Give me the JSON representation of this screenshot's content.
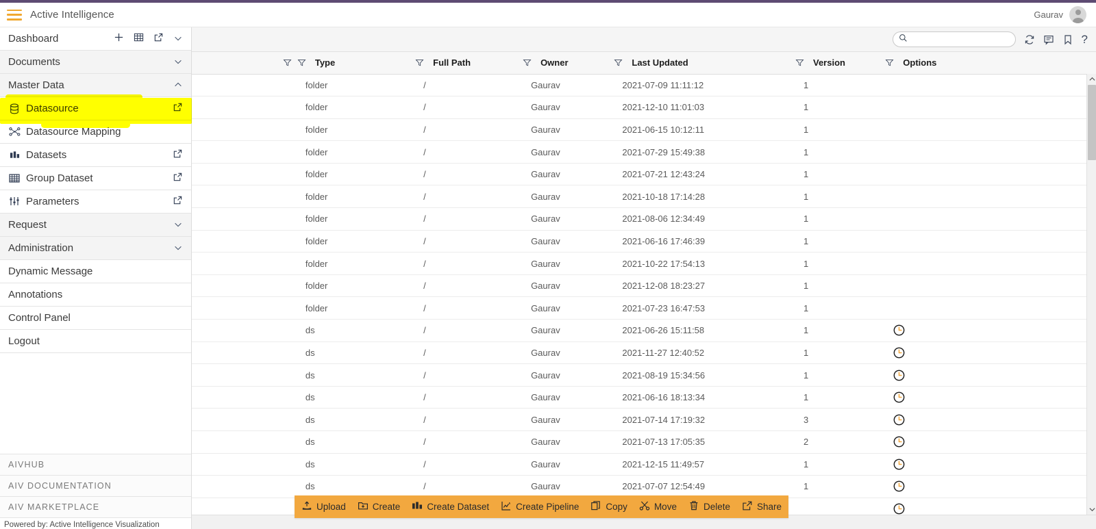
{
  "app": {
    "title": "Active Intelligence",
    "user": "Gaurav",
    "menu_icon": "hamburger-icon",
    "avatar_icon": "user-avatar-icon",
    "powered_by": "Powered by: Active Intelligence Visualization",
    "accent_top": "#5e4b73",
    "accent_orange": "#f2a83f",
    "highlight": "#ffff00"
  },
  "sidebar": {
    "items": [
      {
        "label": "Dashboard",
        "icon": null,
        "style": "plain",
        "actions": [
          "plus-icon",
          "table-icon",
          "external-link-icon",
          "chevron-down-icon"
        ]
      },
      {
        "label": "Documents",
        "icon": null,
        "style": "grey",
        "actions": [
          "chevron-down-icon"
        ]
      },
      {
        "label": "Master Data",
        "icon": null,
        "style": "grey",
        "actions": [
          "chevron-up-icon"
        ]
      },
      {
        "label": "Datasource",
        "icon": "database-icon",
        "style": "plain",
        "actions": [
          "external-link-icon"
        ],
        "highlighted": true
      },
      {
        "label": "Datasource Mapping",
        "icon": "datasource-mapping-icon",
        "style": "plain",
        "actions": []
      },
      {
        "label": "Datasets",
        "icon": "dataset-icon",
        "style": "plain",
        "actions": [
          "external-link-icon"
        ]
      },
      {
        "label": "Group Dataset",
        "icon": "group-dataset-icon",
        "style": "plain",
        "actions": [
          "external-link-icon"
        ]
      },
      {
        "label": "Parameters",
        "icon": "sliders-icon",
        "style": "plain",
        "actions": [
          "external-link-icon"
        ]
      },
      {
        "label": "Request",
        "icon": null,
        "style": "grey",
        "actions": [
          "chevron-down-icon"
        ]
      },
      {
        "label": "Administration",
        "icon": null,
        "style": "grey",
        "actions": [
          "chevron-down-icon"
        ]
      },
      {
        "label": "Dynamic Message",
        "icon": null,
        "style": "plain",
        "actions": []
      },
      {
        "label": "Annotations",
        "icon": null,
        "style": "plain",
        "actions": []
      },
      {
        "label": "Control Panel",
        "icon": null,
        "style": "plain",
        "actions": []
      },
      {
        "label": "Logout",
        "icon": null,
        "style": "plain",
        "actions": []
      }
    ],
    "external_links": [
      "AIVHUB",
      "AIV DOCUMENTATION",
      "AIV MARKETPLACE"
    ]
  },
  "toolbar": {
    "search_value": "",
    "search_placeholder": "",
    "icons": [
      "search-icon",
      "refresh-icon",
      "comment-icon",
      "bookmark-icon",
      "help-icon"
    ],
    "help_label": "?"
  },
  "table": {
    "columns": [
      {
        "key": "name",
        "label": "",
        "filter": true
      },
      {
        "key": "type",
        "label": "Type",
        "filter": true
      },
      {
        "key": "path",
        "label": "Full Path",
        "filter": true
      },
      {
        "key": "owner",
        "label": "Owner",
        "filter": true
      },
      {
        "key": "updated",
        "label": "Last Updated",
        "filter": true
      },
      {
        "key": "version",
        "label": "Version",
        "filter": true
      },
      {
        "key": "options",
        "label": "Options",
        "filter": true
      }
    ],
    "rows": [
      {
        "name": "",
        "type": "folder",
        "path": "/",
        "owner": "Gaurav",
        "updated": "2021-07-09 11:11:12",
        "version": "1",
        "options": ""
      },
      {
        "name": "",
        "type": "folder",
        "path": "/",
        "owner": "Gaurav",
        "updated": "2021-12-10 11:01:03",
        "version": "1",
        "options": ""
      },
      {
        "name": "",
        "type": "folder",
        "path": "/",
        "owner": "Gaurav",
        "updated": "2021-06-15 10:12:11",
        "version": "1",
        "options": ""
      },
      {
        "name": "",
        "type": "folder",
        "path": "/",
        "owner": "Gaurav",
        "updated": "2021-07-29 15:49:38",
        "version": "1",
        "options": ""
      },
      {
        "name": "",
        "type": "folder",
        "path": "/",
        "owner": "Gaurav",
        "updated": "2021-07-21 12:43:24",
        "version": "1",
        "options": ""
      },
      {
        "name": "",
        "type": "folder",
        "path": "/",
        "owner": "Gaurav",
        "updated": "2021-10-18 17:14:28",
        "version": "1",
        "options": ""
      },
      {
        "name": "",
        "type": "folder",
        "path": "/",
        "owner": "Gaurav",
        "updated": "2021-08-06 12:34:49",
        "version": "1",
        "options": ""
      },
      {
        "name": "",
        "type": "folder",
        "path": "/",
        "owner": "Gaurav",
        "updated": "2021-06-16 17:46:39",
        "version": "1",
        "options": ""
      },
      {
        "name": "",
        "type": "folder",
        "path": "/",
        "owner": "Gaurav",
        "updated": "2021-10-22 17:54:13",
        "version": "1",
        "options": ""
      },
      {
        "name": "",
        "type": "folder",
        "path": "/",
        "owner": "Gaurav",
        "updated": "2021-12-08 18:23:27",
        "version": "1",
        "options": ""
      },
      {
        "name": "",
        "type": "folder",
        "path": "/",
        "owner": "Gaurav",
        "updated": "2021-07-23 16:47:53",
        "version": "1",
        "options": ""
      },
      {
        "name": "",
        "type": "ds",
        "path": "/",
        "owner": "Gaurav",
        "updated": "2021-06-26 15:11:58",
        "version": "1",
        "options": "clock-icon"
      },
      {
        "name": "",
        "type": "ds",
        "path": "/",
        "owner": "Gaurav",
        "updated": "2021-11-27 12:40:52",
        "version": "1",
        "options": "clock-icon"
      },
      {
        "name": "",
        "type": "ds",
        "path": "/",
        "owner": "Gaurav",
        "updated": "2021-08-19 15:34:56",
        "version": "1",
        "options": "clock-icon"
      },
      {
        "name": "",
        "type": "ds",
        "path": "/",
        "owner": "Gaurav",
        "updated": "2021-06-16 18:13:34",
        "version": "1",
        "options": "clock-icon"
      },
      {
        "name": "",
        "type": "ds",
        "path": "/",
        "owner": "Gaurav",
        "updated": "2021-07-14 17:19:32",
        "version": "3",
        "options": "clock-icon"
      },
      {
        "name": "",
        "type": "ds",
        "path": "/",
        "owner": "Gaurav",
        "updated": "2021-07-13 17:05:35",
        "version": "2",
        "options": "clock-icon"
      },
      {
        "name": "",
        "type": "ds",
        "path": "/",
        "owner": "Gaurav",
        "updated": "2021-12-15 11:49:57",
        "version": "1",
        "options": "clock-icon"
      },
      {
        "name": "",
        "type": "ds",
        "path": "/",
        "owner": "Gaurav",
        "updated": "2021-07-07 12:54:49",
        "version": "1",
        "options": "clock-icon"
      },
      {
        "name": "",
        "type": "",
        "path": "",
        "owner": "",
        "updated": "",
        "version": "",
        "options": "clock-icon"
      }
    ]
  },
  "actionbar": {
    "actions": [
      {
        "label": "Upload",
        "icon": "upload-icon"
      },
      {
        "label": "Create",
        "icon": "create-folder-icon"
      },
      {
        "label": "Create Dataset",
        "icon": "dataset-icon"
      },
      {
        "label": "Create Pipeline",
        "icon": "pipeline-icon"
      },
      {
        "label": "Copy",
        "icon": "copy-icon"
      },
      {
        "label": "Move",
        "icon": "scissors-icon"
      },
      {
        "label": "Delete",
        "icon": "trash-icon"
      },
      {
        "label": "Share",
        "icon": "share-icon"
      }
    ]
  }
}
